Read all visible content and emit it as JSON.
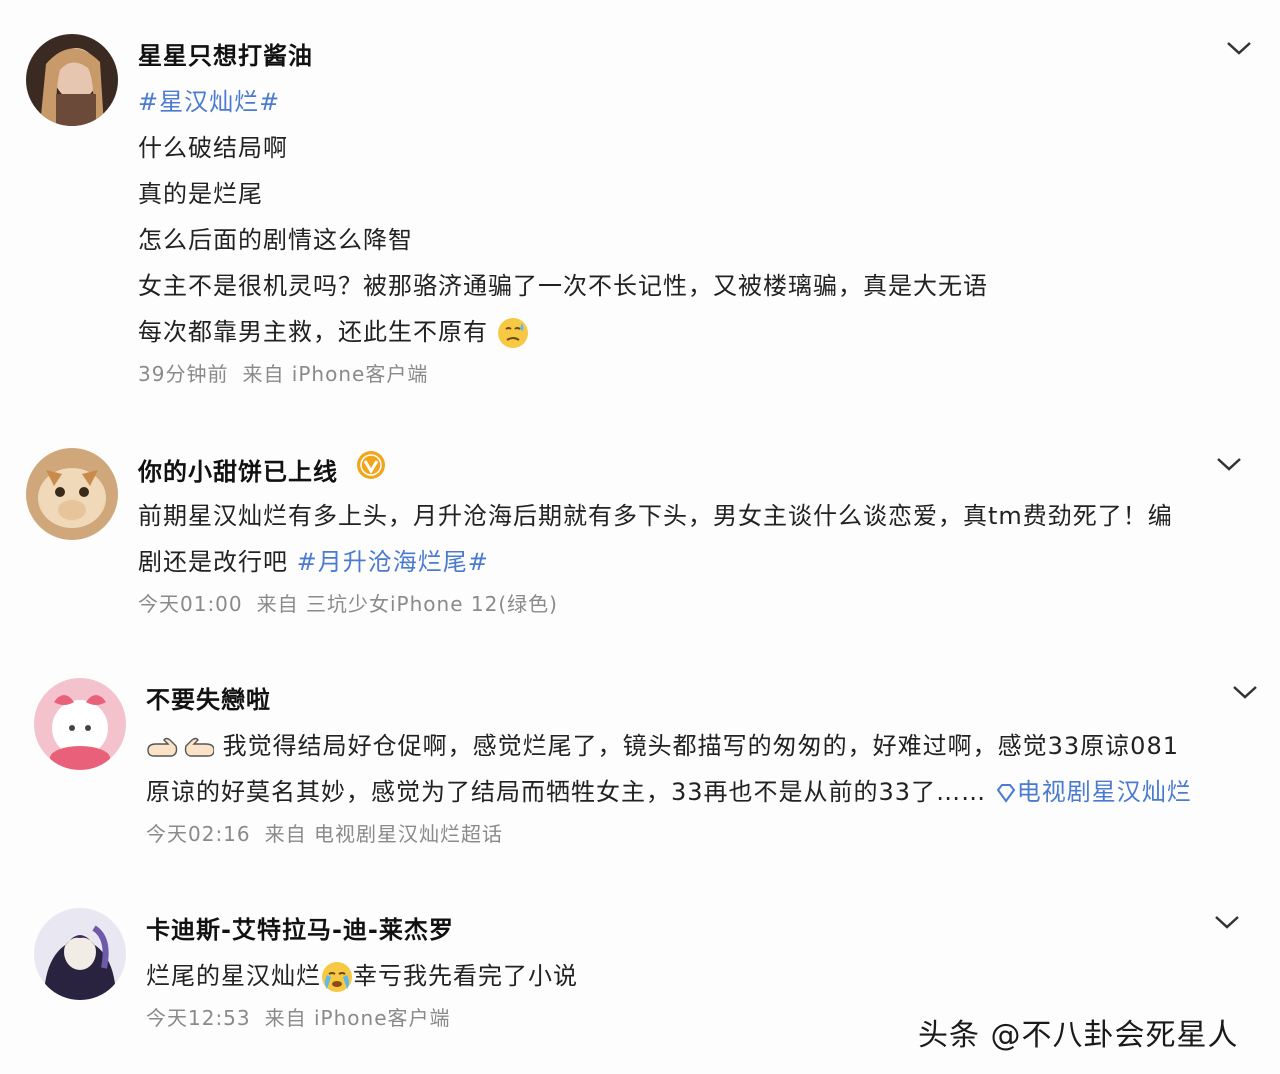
{
  "posts": [
    {
      "username": "星星只想打酱油",
      "lines": [
        "#星汉灿烂#",
        "什么破结局啊",
        "真的是烂尾",
        "怎么后面的剧情这么降智",
        "女主不是很机灵吗？被那骆济通骗了一次不长记性，又被楼璃骗，真是大无语",
        "每次都靠男主救，还此生不原有"
      ],
      "time": "39分钟前",
      "source": "来自 iPhone客户端"
    },
    {
      "username": "你的小甜饼已上线",
      "line1": "前期星汉灿烂有多上头，月升沧海后期就有多下头，男女主谈什么谈恋爱，真tm费劲死了！编",
      "line2_text": "剧还是改行吧 ",
      "line2_tag": "#月升沧海烂尾#",
      "time": "今天01:00",
      "source": "来自 三坑少女iPhone 12(绿色)"
    },
    {
      "username": "不要失戀啦",
      "line1": "我觉得结局好仓促啊，感觉烂尾了，镜头都描写的匆匆的，好难过啊，感觉33原谅081",
      "line2_text": "原谅的好莫名其妙，感觉为了结局而牺牲女主，33再也不是从前的33了……",
      "line2_link": "电视剧星汉灿烂",
      "time": "今天02:16",
      "source": "来自 电视剧星汉灿烂超话"
    },
    {
      "username": "卡迪斯-艾特拉马-迪-莱杰罗",
      "line1_a": "烂尾的星汉灿烂",
      "line1_b": "幸亏我先看完了小说",
      "time": "今天12:53",
      "source": "来自 iPhone客户端"
    }
  ],
  "watermark": "头条 @不八卦会死星人",
  "colors": {
    "link": "#4a7bd0",
    "meta": "#8a8a8a",
    "verified": "#f2a51a"
  },
  "icons": [
    "chevron-down-icon",
    "verified-badge-icon",
    "sweat-emoji-icon",
    "pointing-hand-icon",
    "link-icon",
    "crying-emoji-icon"
  ]
}
